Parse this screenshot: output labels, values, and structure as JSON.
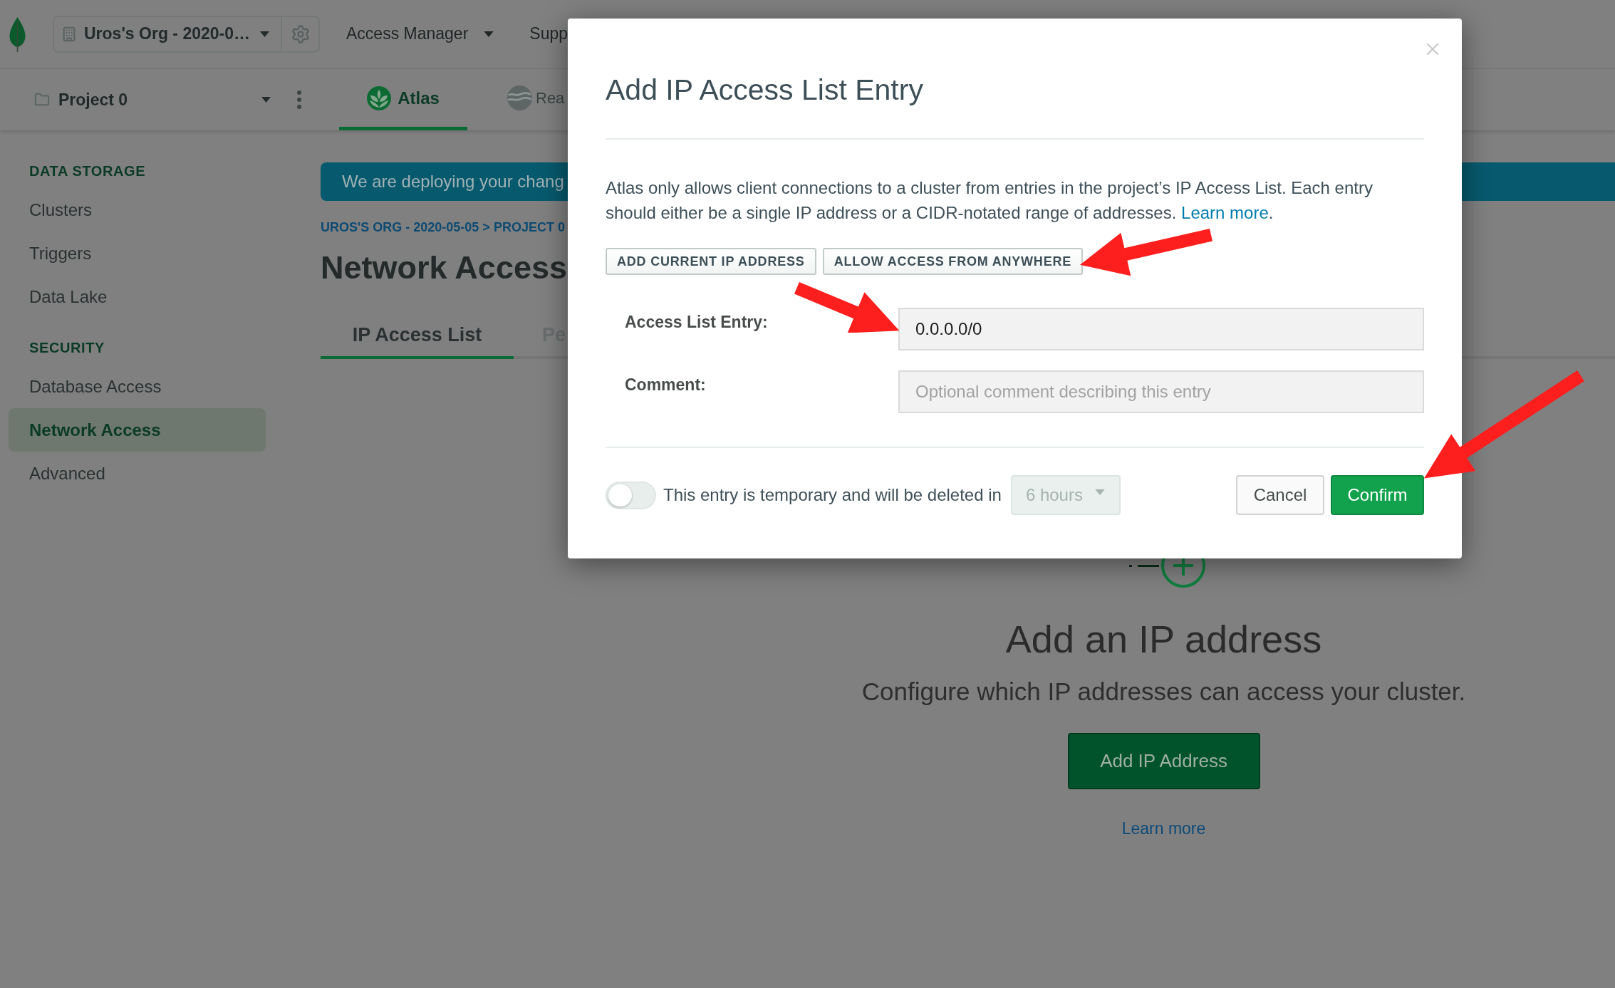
{
  "top_bar": {
    "org": "Uros's Org - 2020-0…",
    "nav": [
      {
        "label": "Access Manager",
        "kind": "dropdown"
      },
      {
        "label": "Supp",
        "kind": "link"
      }
    ]
  },
  "project_bar": {
    "project": "Project 0",
    "tabs": [
      {
        "label": "Atlas",
        "selected": true
      },
      {
        "label": "Rea",
        "selected": false
      }
    ]
  },
  "sidebar": {
    "sections": [
      {
        "heading": "DATA STORAGE",
        "items": [
          {
            "label": "Clusters",
            "selected": false
          },
          {
            "label": "Triggers",
            "selected": false
          },
          {
            "label": "Data Lake",
            "selected": false
          }
        ]
      },
      {
        "heading": "SECURITY",
        "items": [
          {
            "label": "Database Access",
            "selected": false
          },
          {
            "label": "Network Access",
            "selected": true
          },
          {
            "label": "Advanced",
            "selected": false
          }
        ]
      }
    ]
  },
  "banner": {
    "text": "We are deploying your chang"
  },
  "breadcrumb": "UROS'S ORG - 2020-05-05 > PROJECT 0",
  "page_title": "Network Access",
  "page_tabs": [
    {
      "label": "IP Access List",
      "selected": true
    },
    {
      "label": "Pe",
      "selected": false
    }
  ],
  "empty_state": {
    "title": "Add an IP address",
    "subtitle": "Configure which IP addresses can access your cluster.",
    "button": "Add IP Address",
    "link": "Learn more"
  },
  "dialog": {
    "title": "Add IP Access List Entry",
    "description": "Atlas only allows client connections to a cluster from entries in the project’s IP Access List. Each entry should either be a single IP address or a CIDR-notated range of addresses.",
    "description_link": "Learn more",
    "description_end": ".",
    "quick_actions": [
      "ADD CURRENT IP ADDRESS",
      "ALLOW ACCESS FROM ANYWHERE"
    ],
    "fields": [
      {
        "label": "Access List Entry:",
        "value": "0.0.0.0/0"
      },
      {
        "label": "Comment:",
        "placeholder": "Optional comment describing this entry"
      }
    ],
    "temporary": {
      "on": false,
      "label": "This entry is temporary and will be deleted in",
      "duration": {
        "value": "6 hours",
        "disabled": true
      }
    },
    "buttons": [
      {
        "label": "Cancel",
        "kind": "secondary"
      },
      {
        "label": "Confirm",
        "kind": "primary"
      }
    ]
  }
}
